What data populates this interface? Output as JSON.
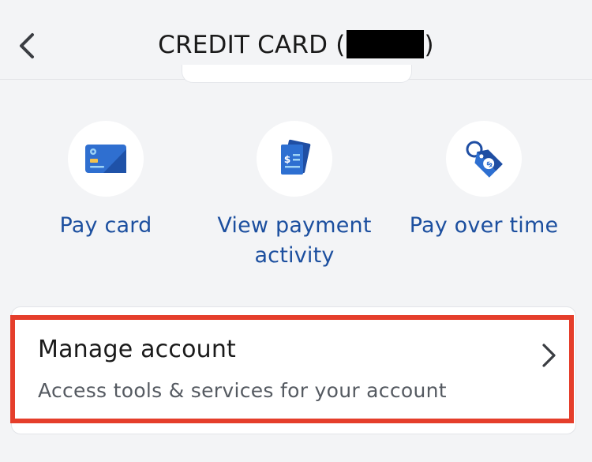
{
  "header": {
    "title_prefix": "CREDIT CARD (",
    "title_suffix": ")",
    "back_icon": "chevron-left-icon"
  },
  "actions": [
    {
      "label": "Pay card",
      "icon": "credit-card-icon"
    },
    {
      "label": "View payment activity",
      "icon": "payment-documents-icon"
    },
    {
      "label": "Pay over time",
      "icon": "dollar-tag-icon"
    }
  ],
  "manage": {
    "title": "Manage account",
    "subtitle": "Access tools & services for your account",
    "icon": "chevron-right-icon"
  },
  "colors": {
    "accent": "#1c4f9f",
    "highlight": "#e53e2b",
    "background": "#f3f4f6"
  }
}
